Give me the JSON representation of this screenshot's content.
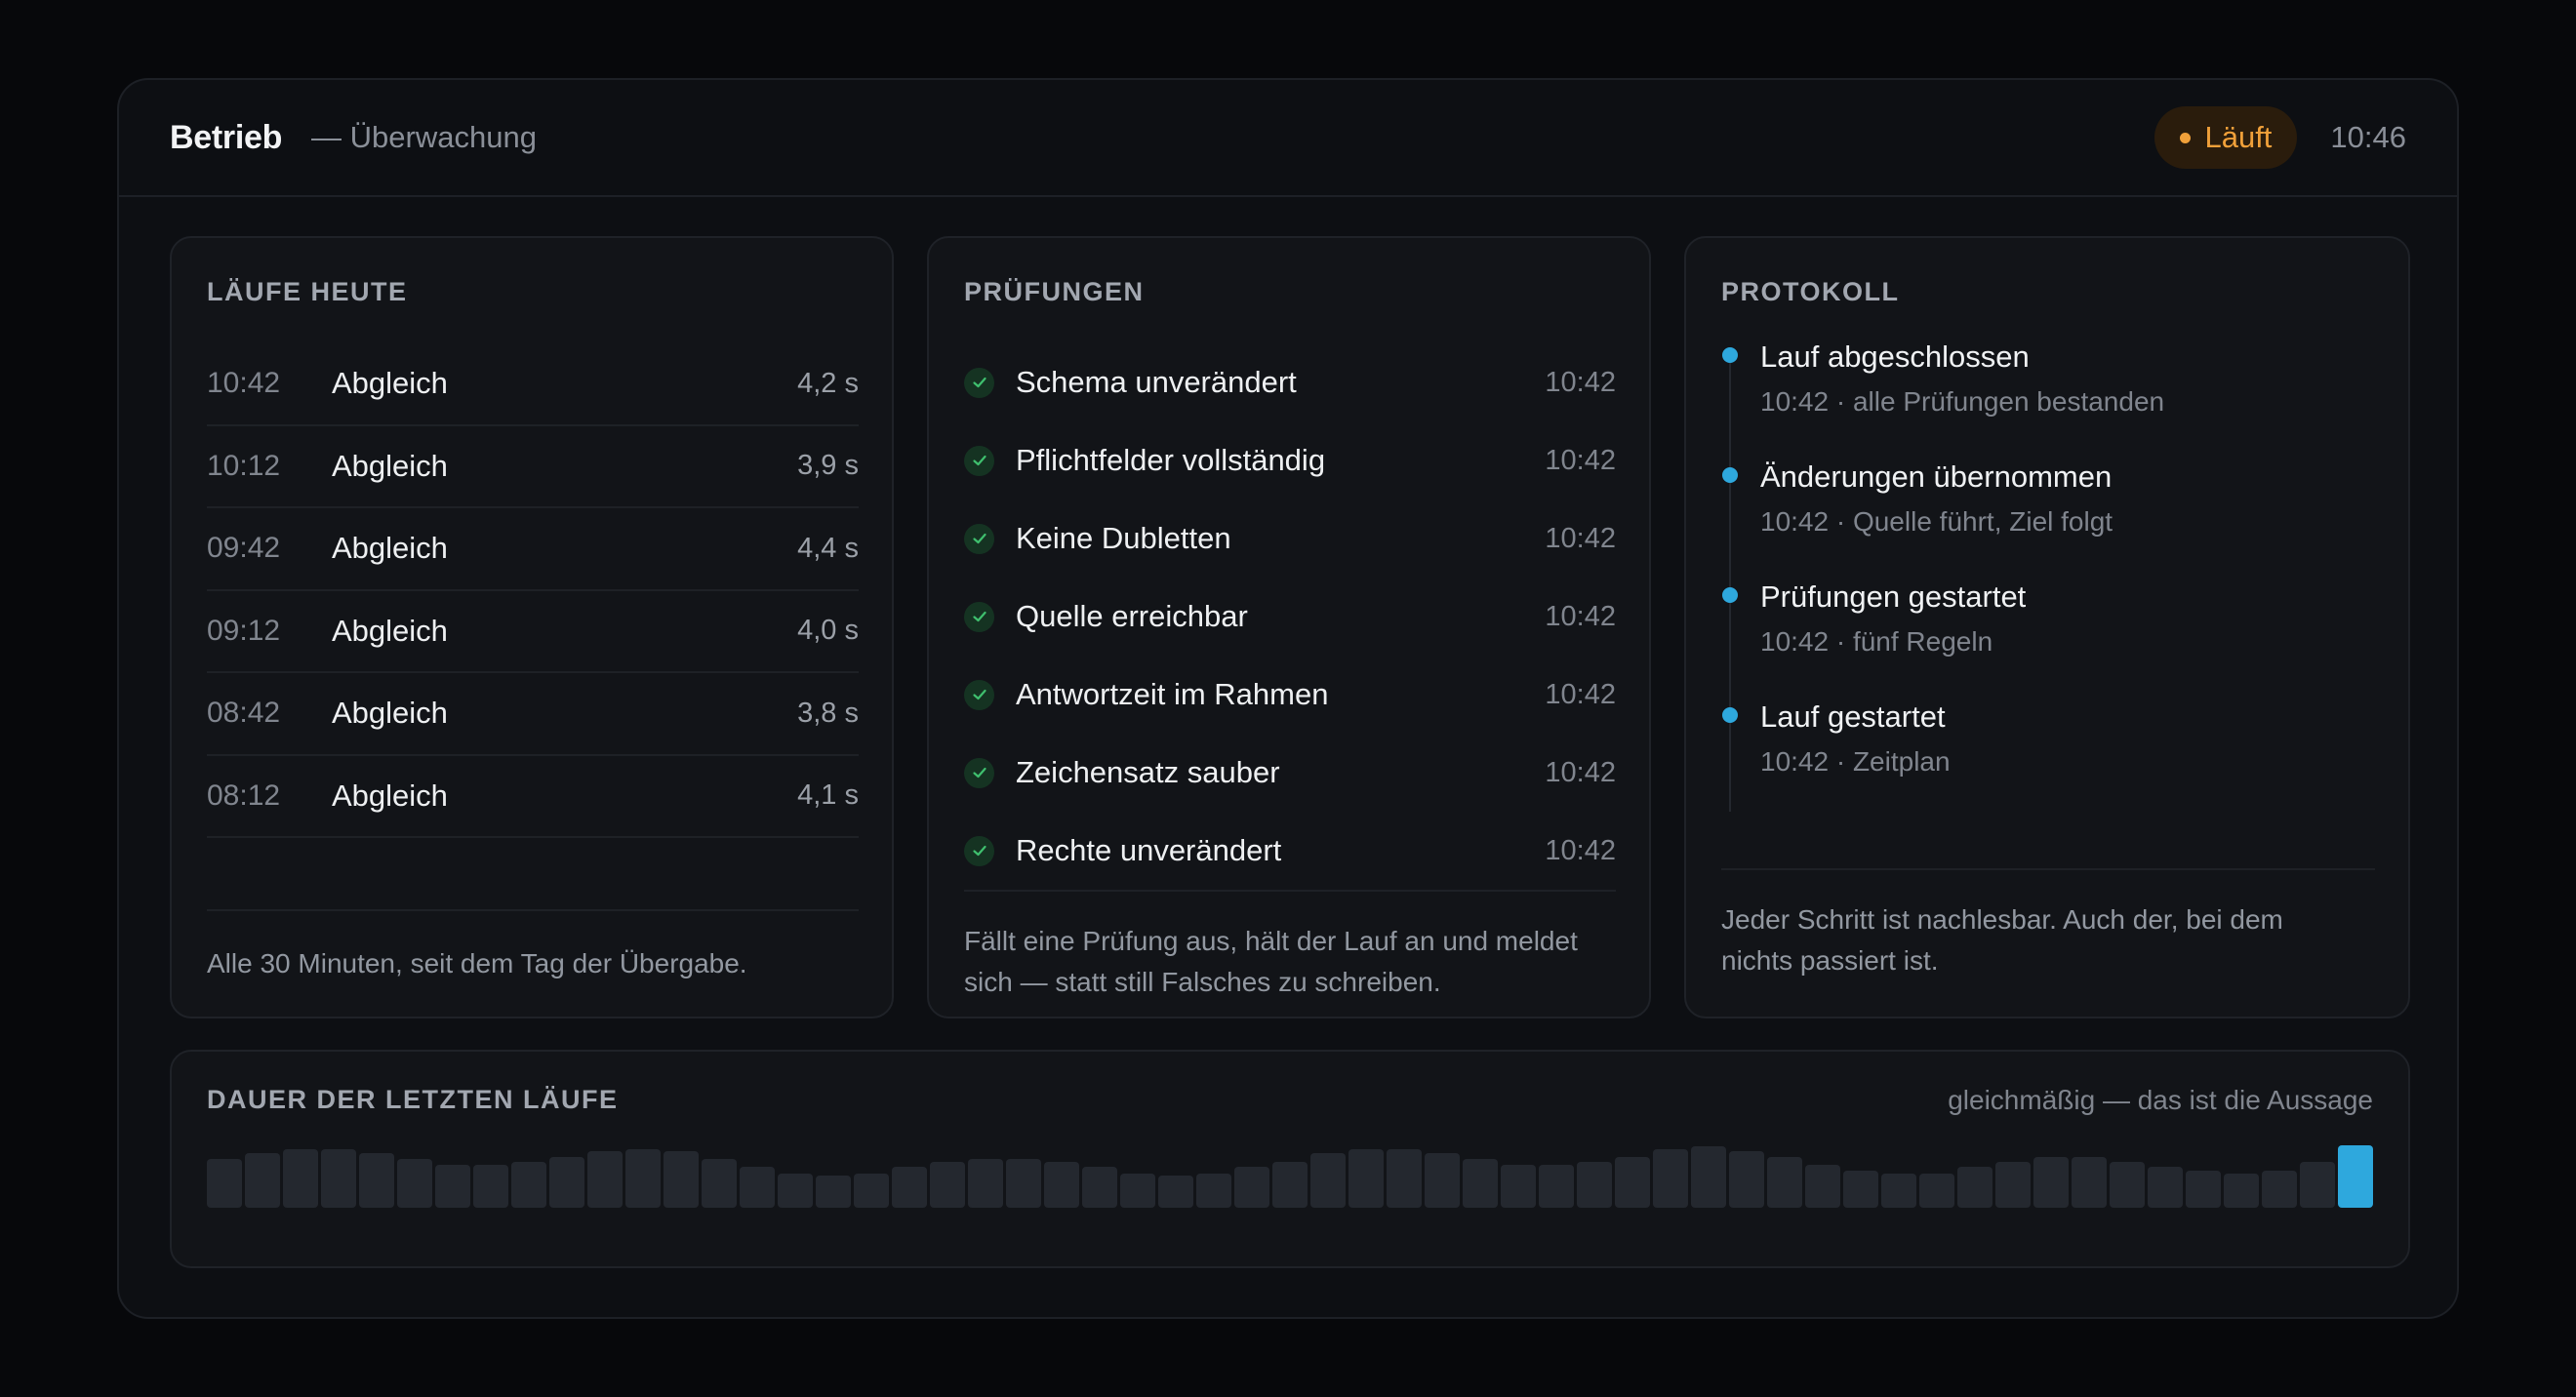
{
  "header": {
    "title": "Betrieb",
    "subtitle": "— Überwachung",
    "status": "Läuft",
    "time": "10:46"
  },
  "runs": {
    "title": "Läufe heute",
    "items": [
      {
        "time": "10:42",
        "name": "Abgleich",
        "duration": "4,2 s"
      },
      {
        "time": "10:12",
        "name": "Abgleich",
        "duration": "3,9 s"
      },
      {
        "time": "09:42",
        "name": "Abgleich",
        "duration": "4,4 s"
      },
      {
        "time": "09:12",
        "name": "Abgleich",
        "duration": "4,0 s"
      },
      {
        "time": "08:42",
        "name": "Abgleich",
        "duration": "3,8 s"
      },
      {
        "time": "08:12",
        "name": "Abgleich",
        "duration": "4,1 s"
      }
    ],
    "footer": "Alle 30 Minuten, seit dem Tag der Übergabe."
  },
  "checks": {
    "title": "Prüfungen",
    "items": [
      {
        "name": "Schema unverändert",
        "time": "10:42"
      },
      {
        "name": "Pflichtfelder vollständig",
        "time": "10:42"
      },
      {
        "name": "Keine Dubletten",
        "time": "10:42"
      },
      {
        "name": "Quelle erreichbar",
        "time": "10:42"
      },
      {
        "name": "Antwortzeit im Rahmen",
        "time": "10:42"
      },
      {
        "name": "Zeichensatz sauber",
        "time": "10:42"
      },
      {
        "name": "Rechte unverändert",
        "time": "10:42"
      }
    ],
    "footer_line1": "Fällt eine Prüfung aus, hält der Lauf an und meldet",
    "footer_line2": "sich — statt still Falsches zu schreiben."
  },
  "log": {
    "title": "Protokoll",
    "items": [
      {
        "title": "Lauf abgeschlossen",
        "sub": "10:42 · alle Prüfungen bestanden"
      },
      {
        "title": "Änderungen übernommen",
        "sub": "10:42 · Quelle führt, Ziel folgt"
      },
      {
        "title": "Prüfungen gestartet",
        "sub": "10:42 · fünf Regeln"
      },
      {
        "title": "Lauf gestartet",
        "sub": "10:42 · Zeitplan"
      }
    ],
    "footer_line1": "Jeder Schritt ist nachlesbar. Auch der, bei dem",
    "footer_line2": "nichts passiert ist."
  },
  "durations": {
    "title": "Dauer der letzten Läufe",
    "note": "gleichmäßig — das ist die Aussage",
    "accent_color": "#2ea8dd",
    "bar_color": "#24282f",
    "levels": [
      0.78,
      0.87,
      0.94,
      0.94,
      0.87,
      0.78,
      0.69,
      0.69,
      0.73,
      0.82,
      0.91,
      0.94,
      0.91,
      0.78,
      0.65,
      0.55,
      0.51,
      0.55,
      0.65,
      0.73,
      0.78,
      0.78,
      0.73,
      0.65,
      0.55,
      0.51,
      0.55,
      0.65,
      0.73,
      0.87,
      0.94,
      0.94,
      0.87,
      0.78,
      0.69,
      0.69,
      0.73,
      0.82,
      0.94,
      0.98,
      0.91,
      0.82,
      0.69,
      0.6,
      0.55,
      0.55,
      0.65,
      0.73,
      0.82,
      0.82,
      0.73,
      0.65,
      0.6,
      0.55,
      0.6,
      0.73,
      1.0
    ]
  }
}
